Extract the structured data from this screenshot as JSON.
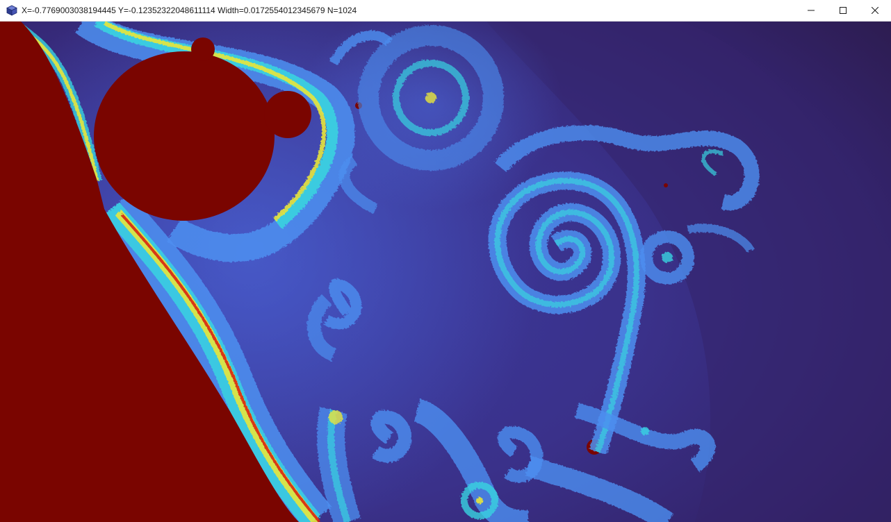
{
  "window": {
    "title": "X=-0.7769003038194445 Y=-0.12352322048611114 Width=0.0172554012345679 N=1024",
    "app_icon": "cube-icon",
    "controls": {
      "minimize_icon": "minimize-icon",
      "maximize_icon": "maximize-icon",
      "close_icon": "close-icon"
    }
  },
  "fractal": {
    "palette": {
      "set_interior": "#7a0500",
      "far_field": "#2f1d4d",
      "mid_field": "#3b3591",
      "near_field": "#4a5ad0",
      "filament_blue": "#4d8ff0",
      "filament_cyan": "#39d3e0",
      "filament_yellow": "#e8e63c",
      "filament_red": "#d8240f"
    }
  }
}
